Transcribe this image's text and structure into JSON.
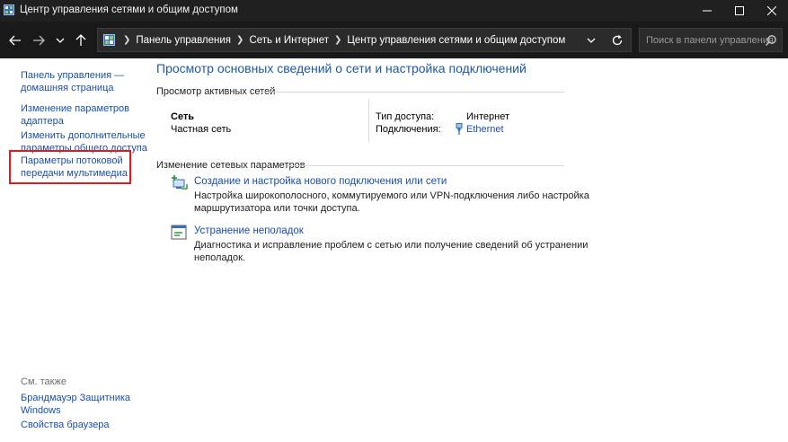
{
  "window": {
    "title": "Центр управления сетями и общим доступом"
  },
  "address_bar": {
    "crumbs": [
      "Панель управления",
      "Сеть и Интернет",
      "Центр управления сетями и общим доступом"
    ],
    "search_placeholder": "Поиск в панели управления"
  },
  "sidebar": {
    "home_line1": "Панель управления —",
    "home_line2": "домашняя страница",
    "adapter_line1": "Изменение параметров",
    "adapter_line2": "адаптера",
    "sharing_line1": "Изменить дополнительные",
    "sharing_line2": "параметры общего доступа",
    "media_line1": "Параметры потоковой",
    "media_line2": "передачи мультимедиа",
    "see_also": "См. также",
    "firewall_line1": "Брандмауэр Защитника",
    "firewall_line2": "Windows",
    "browser": "Свойства браузера"
  },
  "main": {
    "title": "Просмотр основных сведений о сети и настройка подключений",
    "active_section": "Просмотр активных сетей",
    "network_name": "Сеть",
    "network_type": "Частная сеть",
    "access_label": "Тип доступа:",
    "access_value": "Интернет",
    "connections_label": "Подключения:",
    "connections_value": "Ethernet",
    "change_section": "Изменение сетевых параметров",
    "tasks": [
      {
        "link": "Создание и настройка нового подключения или сети",
        "desc_line1": "Настройка широкополосного, коммутируемого или VPN-подключения либо настройка",
        "desc_line2": "маршрутизатора или точки доступа."
      },
      {
        "link": "Устранение неполадок",
        "desc_line1": "Диагностика и исправление проблем с сетью или получение сведений об устранении",
        "desc_line2": "неполадок."
      }
    ]
  },
  "colors": {
    "link": "#1a4fa3",
    "title_link": "#1c5aa3",
    "highlight": "#e01b1b",
    "titlebar": "#202020",
    "navbar": "#191919"
  }
}
